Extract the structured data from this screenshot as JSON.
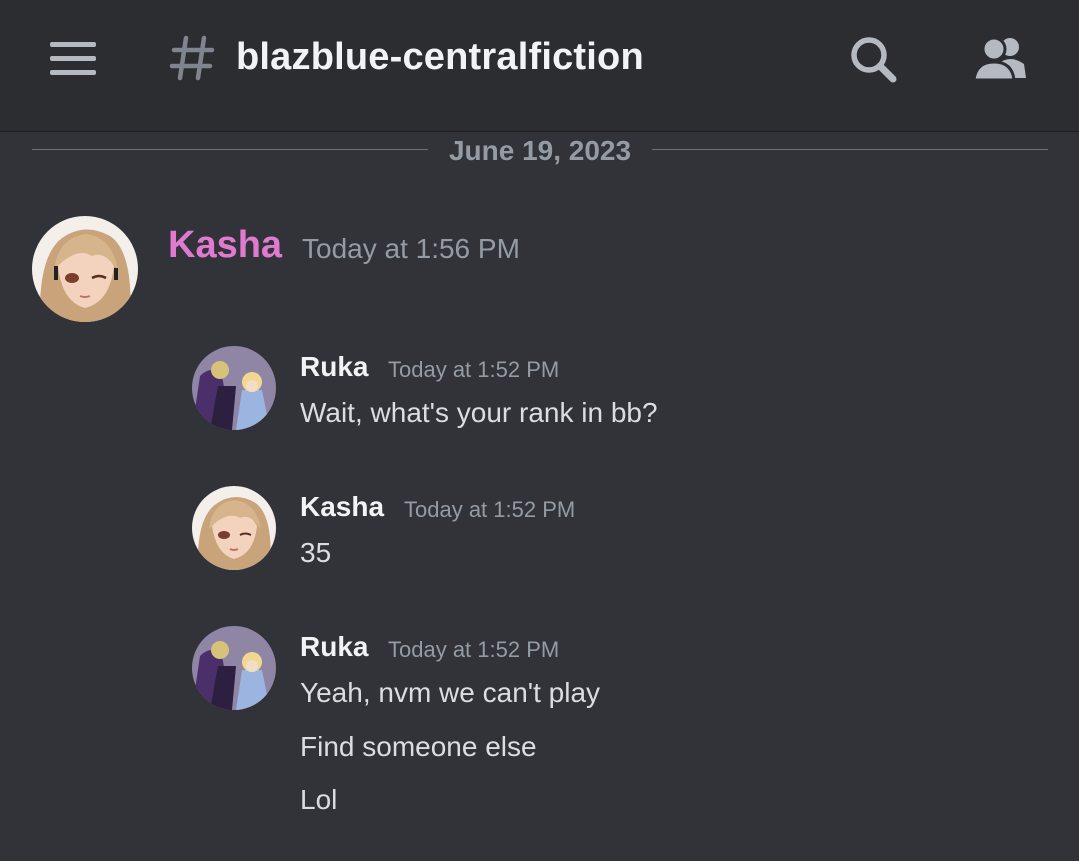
{
  "header": {
    "menu_icon": "hamburger-menu-icon",
    "channel_icon": "hash-icon",
    "channel_name": "blazblue-centralfiction",
    "search_icon": "search-icon",
    "members_icon": "members-icon"
  },
  "date_divider": "June 19, 2023",
  "main_message": {
    "author": "Kasha",
    "author_color": "#e07ad0",
    "timestamp": "Today at 1:56 PM"
  },
  "forwarded_messages": [
    {
      "author": "Ruka",
      "timestamp": "Today at 1:52 PM",
      "lines": [
        "Wait, what's your rank in bb?"
      ]
    },
    {
      "author": "Kasha",
      "timestamp": "Today at 1:52 PM",
      "lines": [
        "35"
      ]
    },
    {
      "author": "Ruka",
      "timestamp": "Today at 1:52 PM",
      "lines": [
        "Yeah, nvm we can't play",
        "Find someone else",
        "Lol"
      ]
    }
  ],
  "colors": {
    "background": "#313338",
    "header_background": "#2b2d31",
    "muted_text": "#949ba4",
    "message_text": "#dbdee1"
  }
}
